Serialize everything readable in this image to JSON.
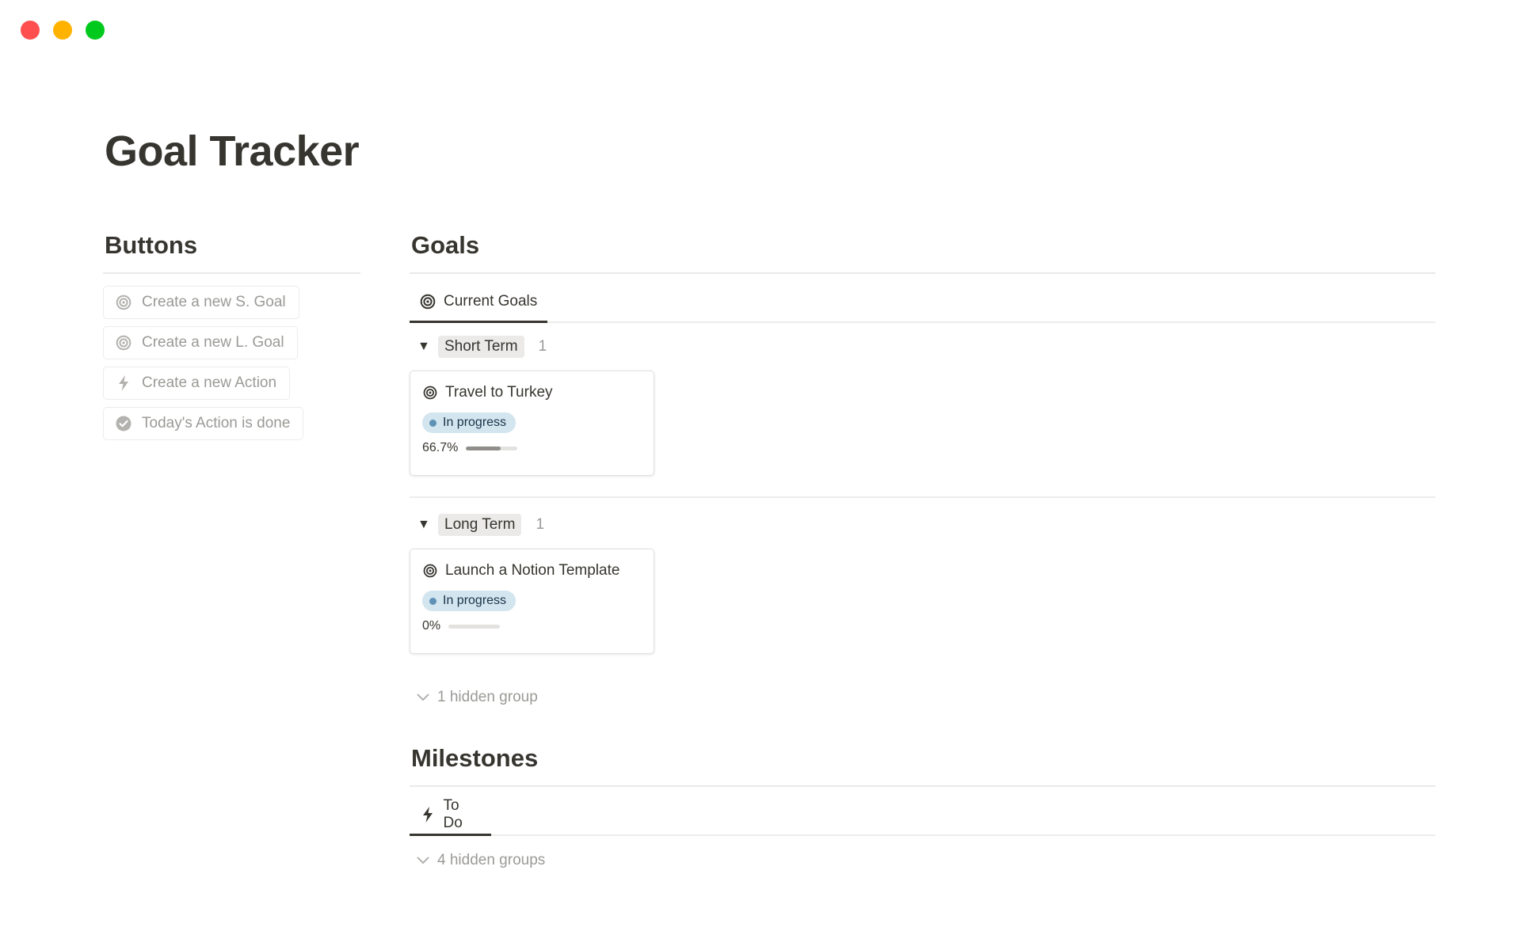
{
  "window": {
    "controls": [
      {
        "name": "close",
        "color": "#ff4f4f"
      },
      {
        "name": "minimize",
        "color": "#ffb300"
      },
      {
        "name": "maximize",
        "color": "#00c91e"
      }
    ]
  },
  "page": {
    "title": "Goal Tracker"
  },
  "buttons_section": {
    "heading": "Buttons",
    "items": [
      {
        "label": "Create a new S. Goal",
        "icon": "target-icon"
      },
      {
        "label": "Create a new L. Goal",
        "icon": "target-icon"
      },
      {
        "label": "Create a new Action",
        "icon": "lightning-icon"
      },
      {
        "label": "Today's Action is done",
        "icon": "check-circle-icon"
      }
    ]
  },
  "goals_section": {
    "heading": "Goals",
    "view_tab": {
      "label": "Current Goals",
      "icon": "target-icon"
    },
    "groups": [
      {
        "name": "Short Term",
        "count": "1",
        "cards": [
          {
            "title": "Travel to Turkey",
            "icon": "target-icon",
            "status": "In progress",
            "progress_label": "66.7%",
            "progress": 0.667
          }
        ]
      },
      {
        "name": "Long Term",
        "count": "1",
        "cards": [
          {
            "title": "Launch a Notion Template",
            "icon": "target-icon",
            "status": "In progress",
            "progress_label": "0%",
            "progress": 0
          }
        ]
      }
    ],
    "hidden_groups_label": "1 hidden group"
  },
  "milestones_section": {
    "heading": "Milestones",
    "view_tab": {
      "label": "To Do",
      "icon": "lightning-icon"
    },
    "hidden_groups_label": "4 hidden groups"
  },
  "colors": {
    "text": "#37352f",
    "muted": "#9b9a97",
    "status_pill_bg": "#d3e5ef",
    "status_dot": "#5f91b6",
    "progress_fill": "#8f8e8b"
  }
}
